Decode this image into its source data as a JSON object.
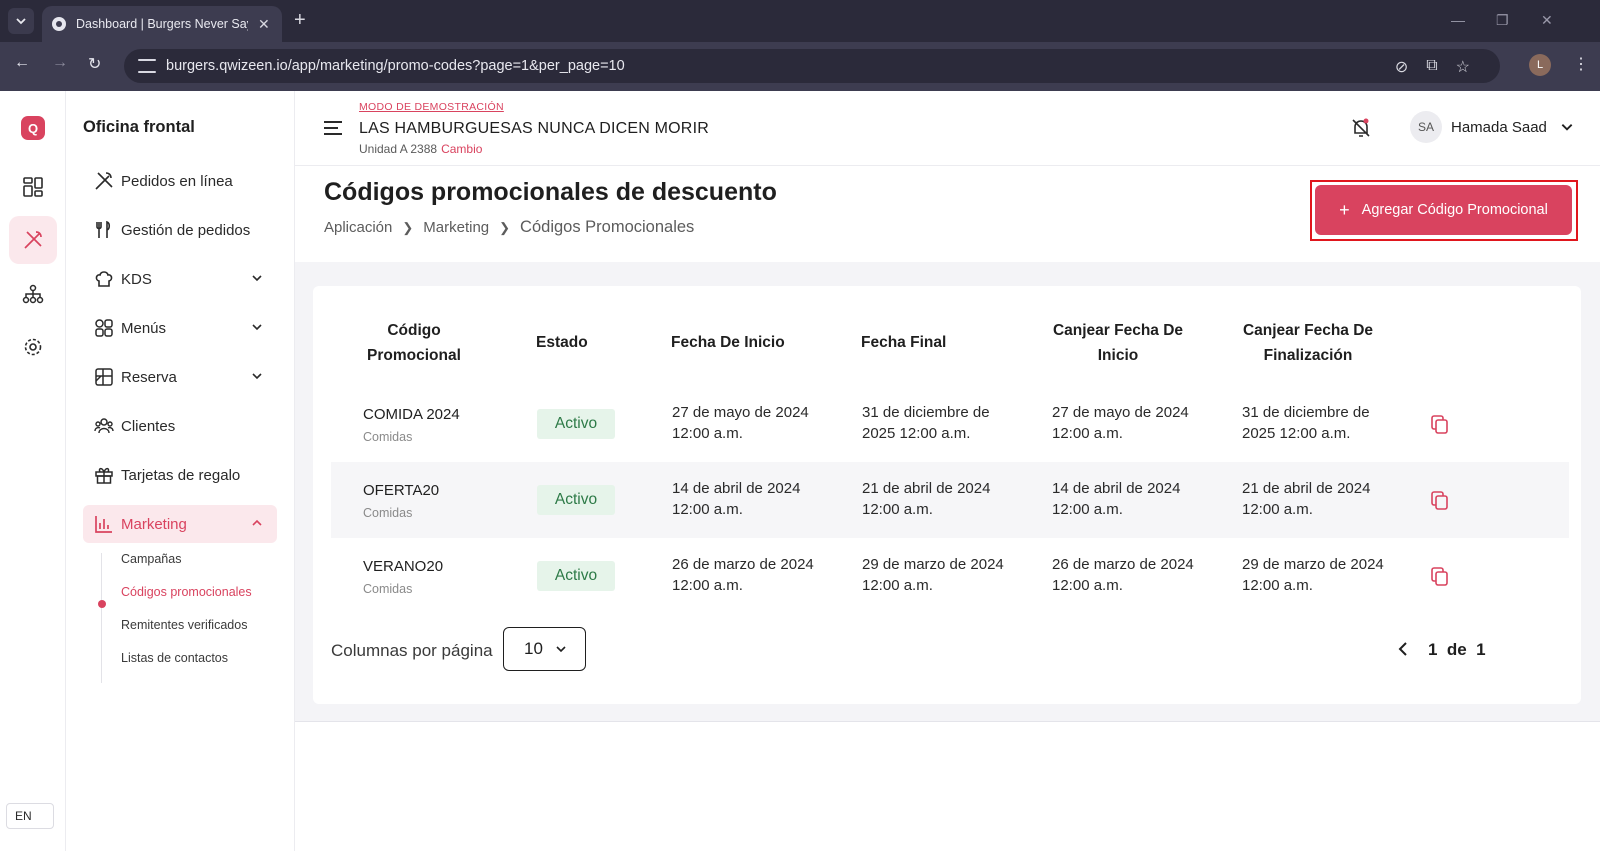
{
  "browser": {
    "tab_title": "Dashboard | Burgers Never Say",
    "url": "burgers.qwizeen.io/app/marketing/promo-codes?page=1&per_page=10",
    "profile_initial": "L"
  },
  "rail": {
    "logo_letter": "Q",
    "language": "EN"
  },
  "sidebar": {
    "title": "Oficina frontal",
    "items": [
      {
        "label": "Pedidos en línea",
        "icon": "utensils-crossed-icon"
      },
      {
        "label": "Gestión de pedidos",
        "icon": "fork-knife-icon"
      },
      {
        "label": "KDS",
        "icon": "chef-hat-icon"
      },
      {
        "label": "Menús",
        "icon": "grid-icon"
      },
      {
        "label": "Reserva",
        "icon": "table-icon"
      },
      {
        "label": "Clientes",
        "icon": "users-icon"
      },
      {
        "label": "Tarjetas de regalo",
        "icon": "gift-icon"
      },
      {
        "label": "Marketing",
        "icon": "bar-chart-icon"
      }
    ],
    "sub_items": [
      {
        "label": "Campañas"
      },
      {
        "label": "Códigos promocionales"
      },
      {
        "label": "Remitentes verificados"
      },
      {
        "label": "Listas de contactos"
      }
    ]
  },
  "topbar": {
    "demo_mode": "MODO DE DEMOSTRACIÓN",
    "restaurant_name": "LAS HAMBURGUESAS NUNCA DICEN MORIR",
    "unit": "Unidad A 2388",
    "change": "Cambio",
    "user_initials": "SA",
    "user_name": "Hamada Saad"
  },
  "page": {
    "title": "Códigos promocionales de descuento",
    "breadcrumb": [
      "Aplicación",
      "Marketing",
      "Códigos Promocionales"
    ],
    "add_button": "Agregar Código Promocional"
  },
  "table": {
    "headers": [
      [
        "Código",
        "Promocional"
      ],
      [
        "Estado"
      ],
      [
        "Fecha De Inicio"
      ],
      [
        "Fecha Final"
      ],
      [
        "Canjear Fecha De",
        "Inicio"
      ],
      [
        "Canjear Fecha De",
        "Finalización"
      ]
    ],
    "rows": [
      {
        "code": "COMIDA 2024",
        "category": "Comidas",
        "status": "Activo",
        "start": [
          "27 de mayo de 2024",
          "12:00 a.m."
        ],
        "end": [
          "31 de diciembre de",
          "2025 12:00 a.m."
        ],
        "redeem_start": [
          "27 de mayo de 2024",
          "12:00 a.m."
        ],
        "redeem_end": [
          "31 de diciembre de",
          "2025 12:00 a.m."
        ]
      },
      {
        "code": "OFERTA20",
        "category": "Comidas",
        "status": "Activo",
        "start": [
          "14 de abril de 2024",
          "12:00 a.m."
        ],
        "end": [
          "21 de abril de 2024",
          "12:00 a.m."
        ],
        "redeem_start": [
          "14 de abril de 2024",
          "12:00 a.m."
        ],
        "redeem_end": [
          "21 de abril de 2024",
          "12:00 a.m."
        ]
      },
      {
        "code": "VERANO20",
        "category": "Comidas",
        "status": "Activo",
        "start": [
          "26 de marzo de 2024",
          "12:00 a.m."
        ],
        "end": [
          "29 de marzo de 2024",
          "12:00 a.m."
        ],
        "redeem_start": [
          "26 de marzo de 2024",
          "12:00 a.m."
        ],
        "redeem_end": [
          "29 de marzo de 2024",
          "12:00 a.m."
        ]
      }
    ]
  },
  "pagination": {
    "per_page_label": "Columnas por página",
    "per_page_value": "10",
    "page_text": "1  de  1"
  },
  "colors": {
    "accent": "#d9435f",
    "badge_bg": "#e6f4ea",
    "badge_text": "#2d7a47",
    "highlight_border": "#e0161d"
  }
}
